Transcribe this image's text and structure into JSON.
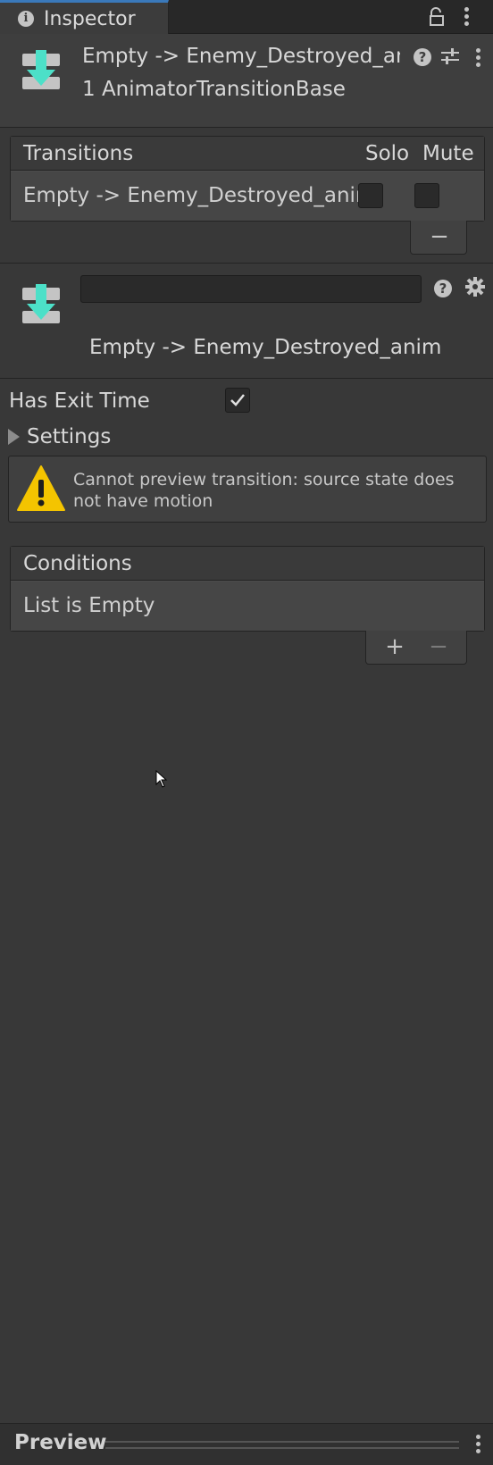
{
  "tab": {
    "label": "Inspector"
  },
  "header": {
    "title": "Empty -> Enemy_Destroyed_ani",
    "subtitle": "1 AnimatorTransitionBase"
  },
  "transitions_list": {
    "header": "Transitions",
    "col_solo": "Solo",
    "col_mute": "Mute",
    "rows": [
      {
        "label": "Empty -> Enemy_Destroyed_anim",
        "solo": false,
        "mute": false
      }
    ],
    "remove_label": "−"
  },
  "transition": {
    "name_field_value": "",
    "name": "Empty -> Enemy_Destroyed_anim"
  },
  "properties": {
    "has_exit_time_label": "Has Exit Time",
    "has_exit_time": true,
    "settings_label": "Settings"
  },
  "warning": {
    "message": "Cannot preview transition: source state does not have motion"
  },
  "conditions": {
    "header": "Conditions",
    "empty_text": "List is Empty",
    "add_label": "+",
    "remove_label": "−"
  },
  "preview": {
    "label": "Preview"
  },
  "colors": {
    "accent_tab": "#3a79bb",
    "icon_teal": "#4ce0c8",
    "warning_yellow": "#f4c400",
    "panel_bg": "#383838"
  }
}
